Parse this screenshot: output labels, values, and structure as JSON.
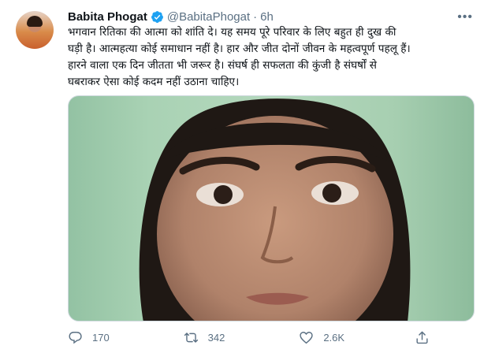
{
  "author": {
    "name": "Babita Phogat",
    "handle": "@BabitaPhogat",
    "separator": "·",
    "time": "6h",
    "verified_color": "#1da1f2"
  },
  "tweet": {
    "text": "भगवान रितिका की आत्मा को शांति दे। यह समय पूरे परिवार के लिए बहुत ही दुख की\nघड़ी है। आत्महत्या कोई समाधान नहीं है। हार और जीत दोनों जीवन के महत्वपूर्ण पहलू हैं।\nहारने वाला एक दिन जीतता भी जरूर है। संघर्ष ही सफलता की कुंजी है संघर्षों से\nघबराकर ऐसा कोई कदम नहीं उठाना चाहिए।"
  },
  "actions": {
    "replies": "170",
    "retweets": "342",
    "likes": "2.6K",
    "icons": [
      "reply-icon",
      "retweet-icon",
      "like-icon",
      "share-icon"
    ]
  },
  "menu": {
    "more_label": "•••"
  },
  "colors": {
    "text": "#0f1419",
    "secondary": "#5b7083",
    "media_bg": "#a9d2b4"
  }
}
